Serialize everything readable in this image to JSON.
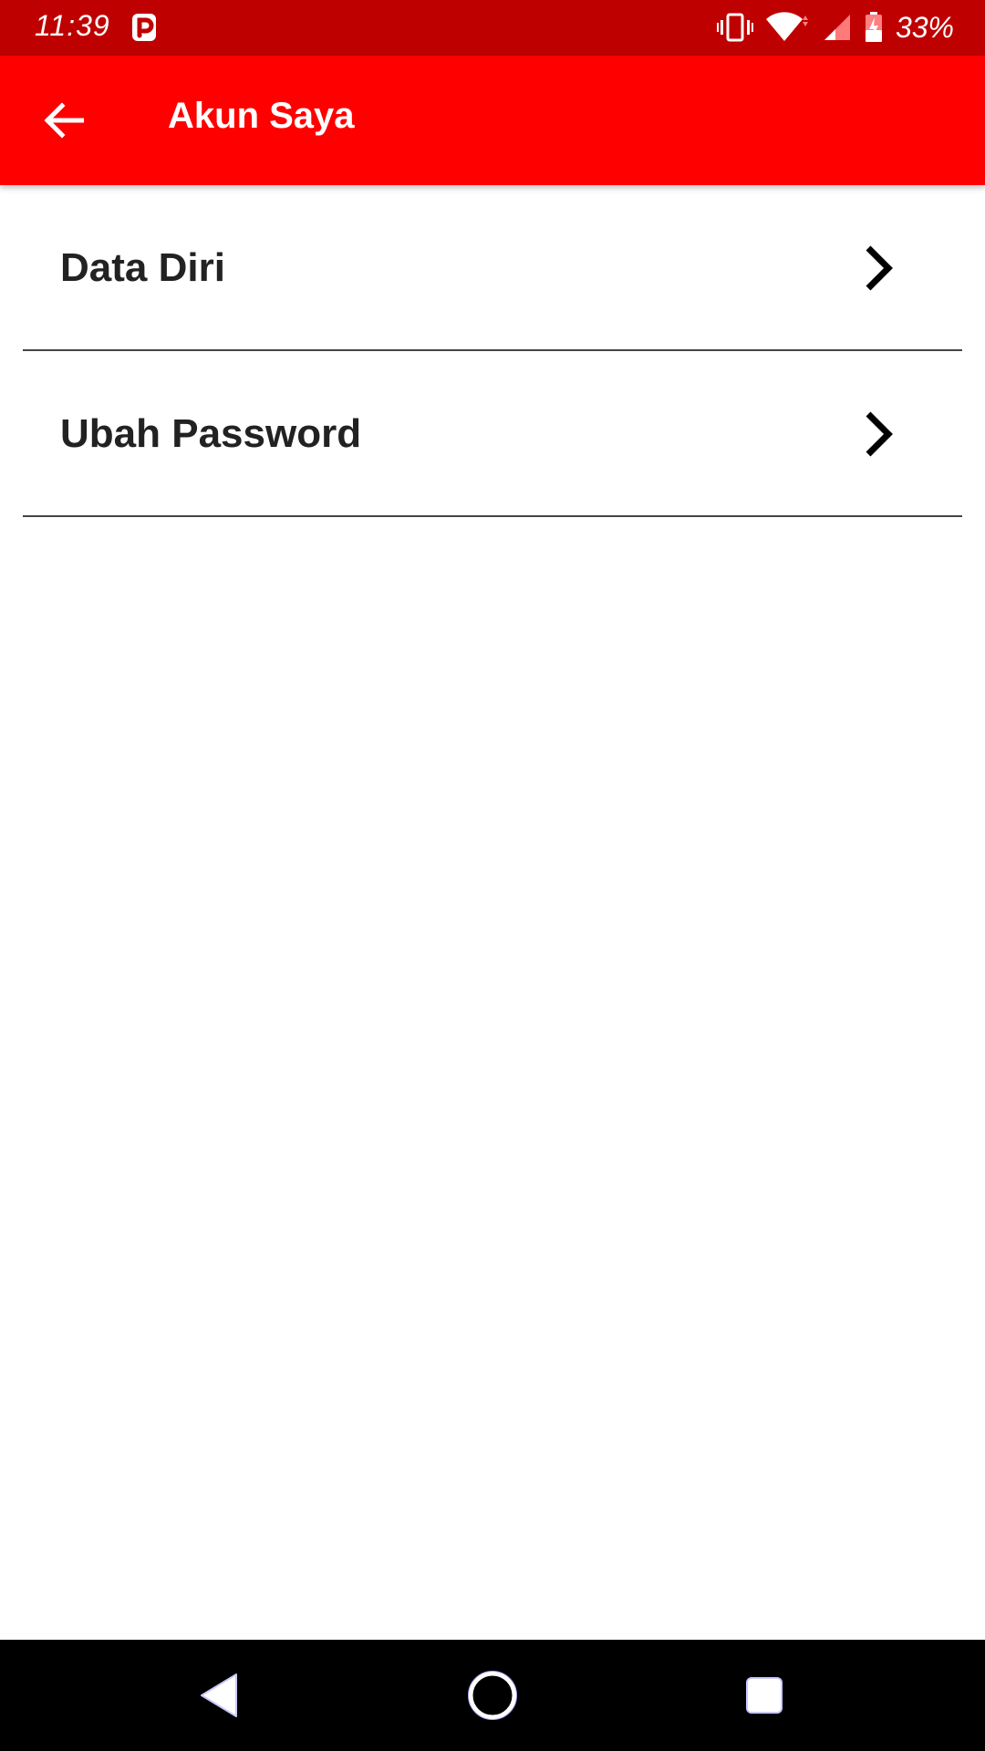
{
  "status_bar": {
    "time": "11:39",
    "battery": "33%",
    "icons": [
      "parking-app-icon",
      "vibrate-icon",
      "wifi-icon",
      "signal-icon",
      "battery-charging-icon"
    ]
  },
  "app_bar": {
    "title": "Akun Saya",
    "back_icon": "arrow-back-icon",
    "background_color": "#ff0000",
    "status_color": "#bf0000"
  },
  "menu": {
    "items": [
      {
        "label": "Data Diri",
        "icon": "chevron-right-icon"
      },
      {
        "label": "Ubah Password",
        "icon": "chevron-right-icon"
      }
    ]
  },
  "nav_bar": {
    "buttons": [
      "back-triangle-icon",
      "home-circle-icon",
      "recents-square-icon"
    ]
  }
}
